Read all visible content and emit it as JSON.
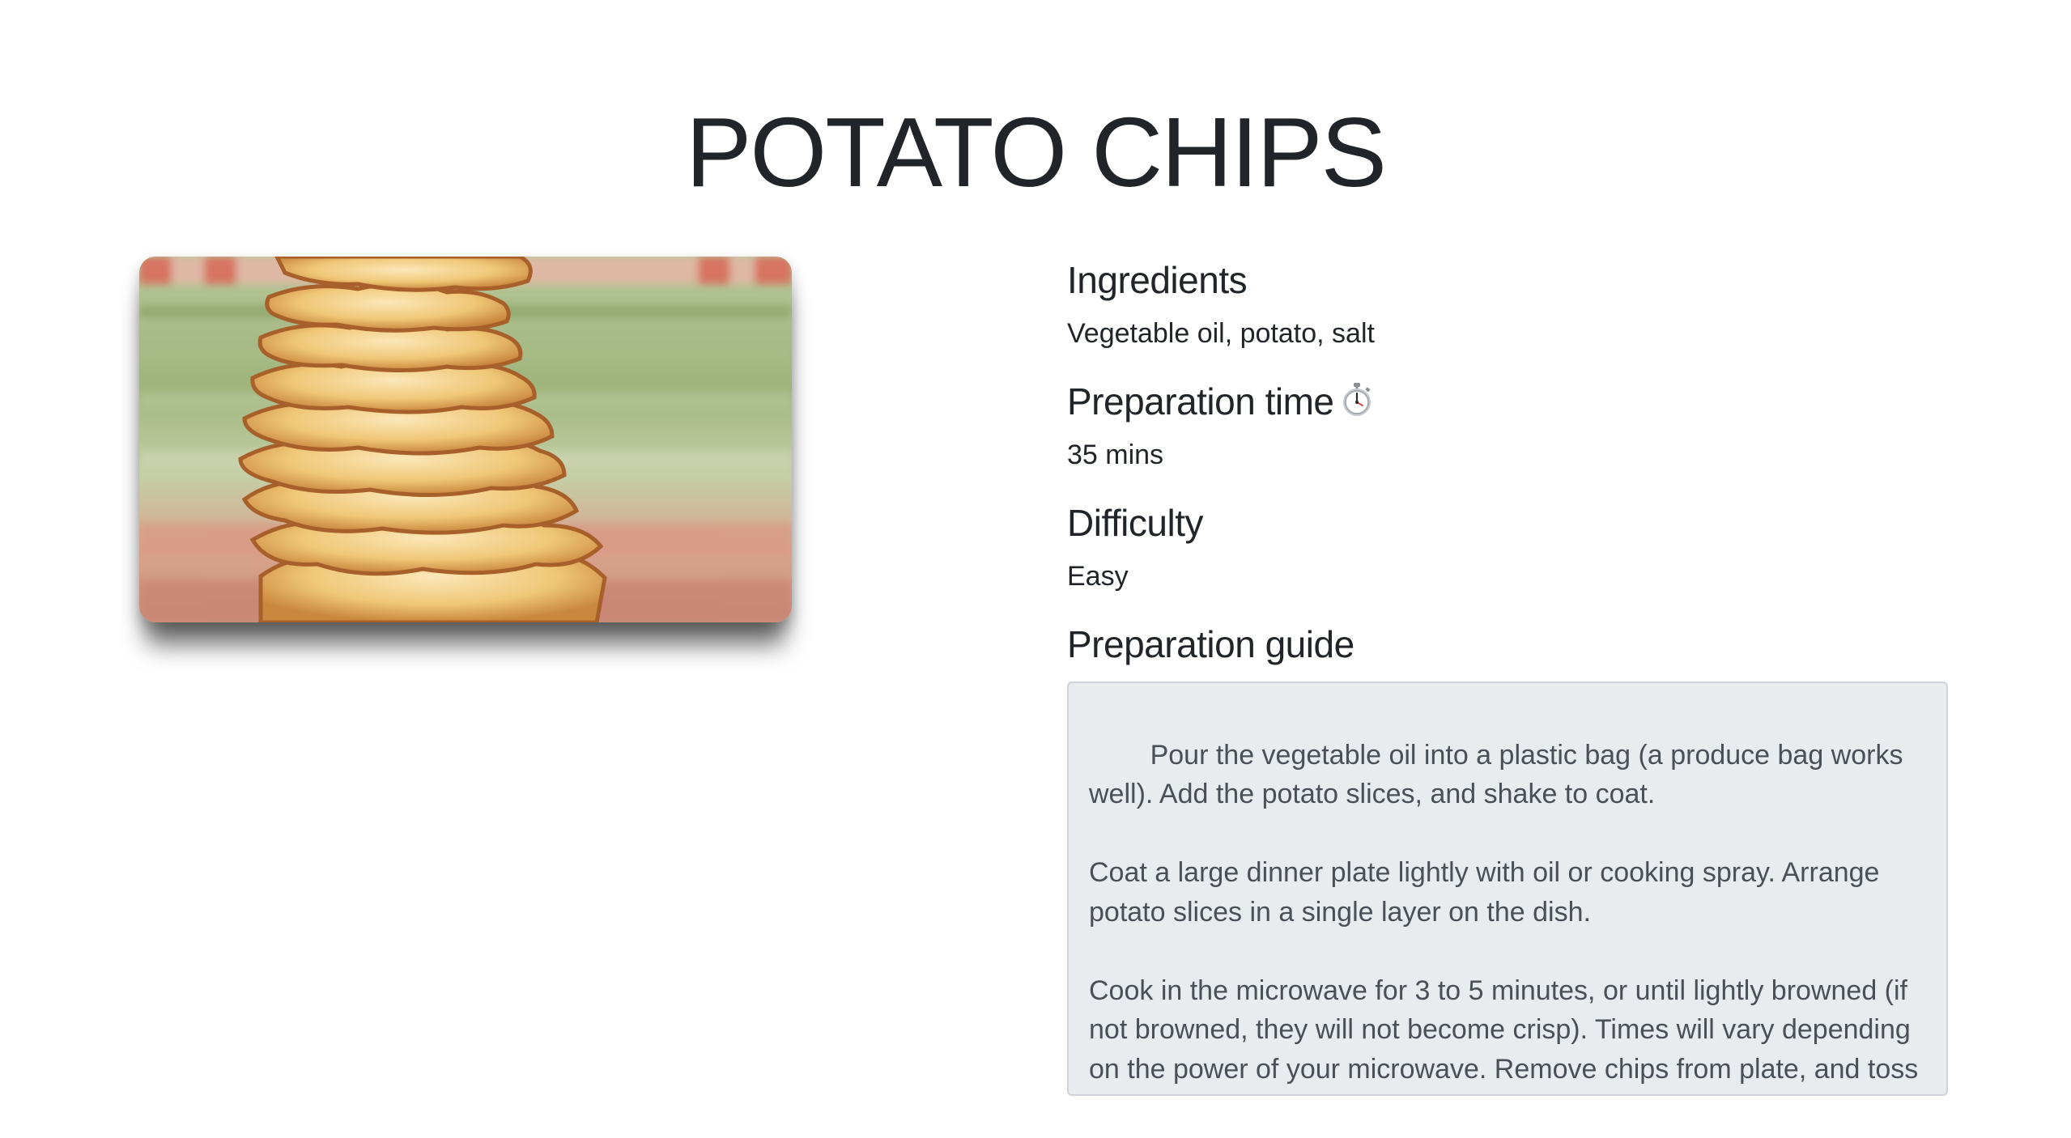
{
  "recipe": {
    "title": "POTATO CHIPS",
    "image_alt": "Stack of potato chips",
    "sections": {
      "ingredients": {
        "heading": "Ingredients",
        "value": "Vegetable oil, potato, salt"
      },
      "preparation_time": {
        "heading": "Preparation time",
        "icon": "stopwatch-icon",
        "value": "35 mins"
      },
      "difficulty": {
        "heading": "Difficulty",
        "value": "Easy"
      },
      "preparation_guide": {
        "heading": "Preparation guide",
        "text": "Pour the vegetable oil into a plastic bag (a produce bag works well). Add the potato slices, and shake to coat.\n\nCoat a large dinner plate lightly with oil or cooking spray. Arrange potato slices in a single layer on the dish.\n\nCook in the microwave for 3 to 5 minutes, or until lightly browned (if not browned, they will not become crisp). Times will vary depending on the power of your microwave. Remove chips from plate, and toss with salt (or other seasonings). Let cool. Repeat process with the remaining"
      }
    }
  },
  "colors": {
    "text": "#212529",
    "guide_background": "#e9ecef",
    "guide_border": "#ced4da",
    "guide_text": "#495057"
  }
}
